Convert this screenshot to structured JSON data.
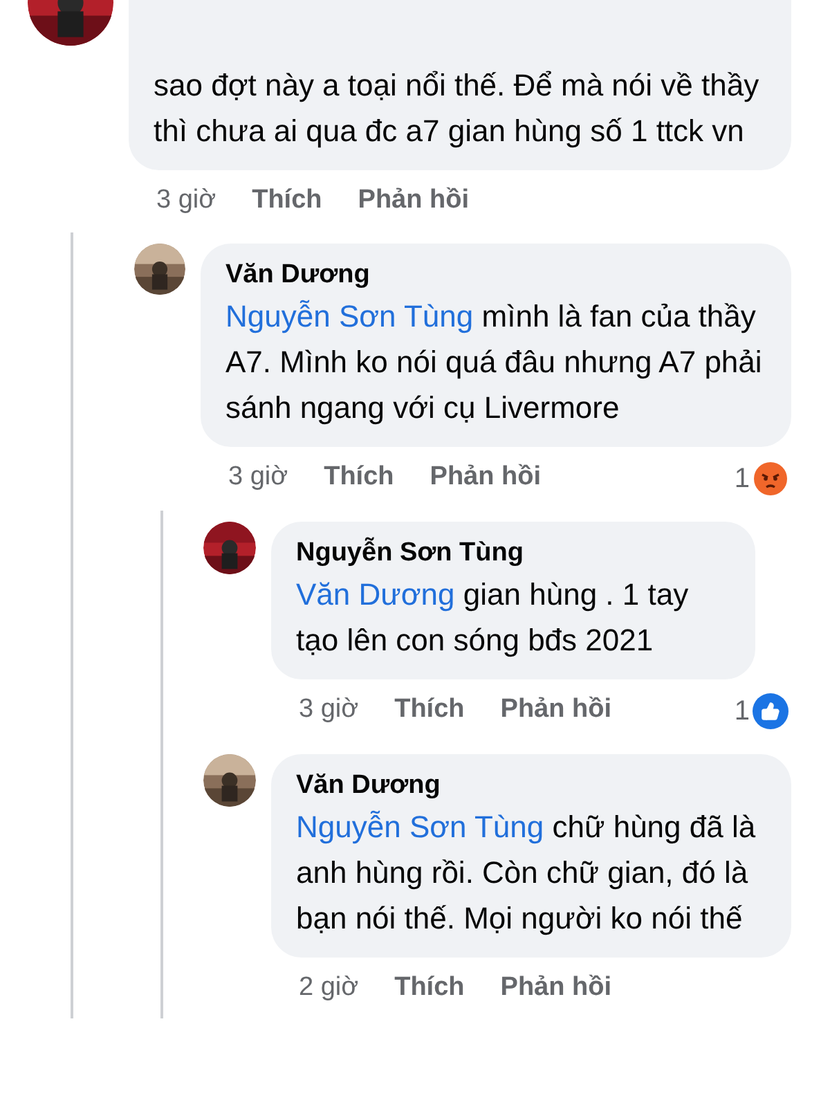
{
  "comments": [
    {
      "text": "sao đợt này a toại nổi thế. Để mà nói về thầy thì chưa ai qua đc a7  gian hùng số 1 ttck vn",
      "time": "3 giờ",
      "like": "Thích",
      "reply": "Phản hồi",
      "children": [
        {
          "author": "Văn Dương",
          "mention": "Nguyễn Sơn Tùng",
          "text": "mình là fan của thầy A7. Mình ko nói quá đâu nhưng A7 phải sánh ngang với  cụ Livermore",
          "time": "3 giờ",
          "like": "Thích",
          "reply": "Phản hồi",
          "reaction": {
            "count": "1",
            "kind": "angry"
          },
          "children": [
            {
              "author": "Nguyễn Sơn Tùng",
              "mention": "Văn Dương",
              "text": " gian hùng . 1 tay tạo lên con sóng bđs 2021",
              "time": "3 giờ",
              "like": "Thích",
              "reply": "Phản hồi",
              "reaction": {
                "count": "1",
                "kind": "like"
              }
            },
            {
              "author": "Văn Dương",
              "mention": "Nguyễn Sơn Tùng",
              "text": "chữ hùng đã là anh hùng rồi. Còn chữ gian, đó là bạn nói thế. Mọi người ko nói thế",
              "time": "2 giờ",
              "like": "Thích",
              "reply": "Phản hồi"
            }
          ]
        }
      ]
    }
  ]
}
